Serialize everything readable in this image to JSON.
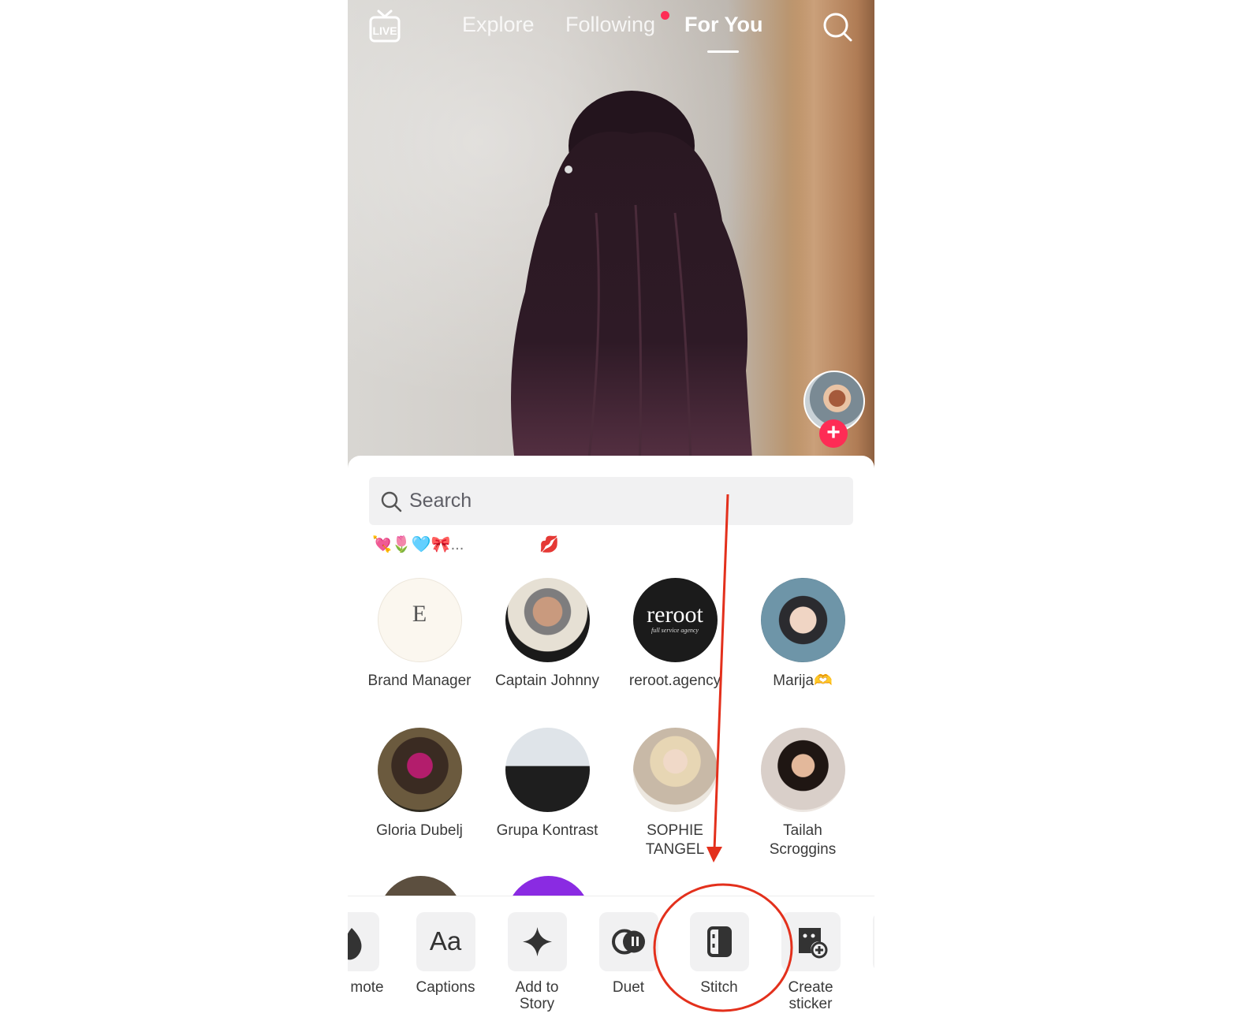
{
  "topnav": {
    "live_label": "LIVE",
    "tabs": [
      "Explore",
      "Following",
      "For You"
    ],
    "active_tab": "For You"
  },
  "share_sheet": {
    "search_placeholder": "Search",
    "emoji_row_1": "💘🌷🩵🎀...",
    "emoji_row_2": "💋",
    "contacts": [
      {
        "name": "Brand Manager",
        "avatar_text": "E"
      },
      {
        "name": "Captain Johnny"
      },
      {
        "name": "reroot.agency",
        "avatar_text": "reroot",
        "avatar_subtext": "full service agency"
      },
      {
        "name": "Marija🫶"
      },
      {
        "name": "Gloria Dubelj"
      },
      {
        "name": "Grupa Kontrast"
      },
      {
        "name": "SOPHIE TANGEL"
      },
      {
        "name": "Tailah Scroggins"
      }
    ],
    "actions": [
      {
        "label": "mote",
        "icon": "promote-flame-icon"
      },
      {
        "label": "Captions",
        "icon": "captions-aa-icon",
        "icon_text": "Aa"
      },
      {
        "label": "Add to Story",
        "icon": "sparkle-icon"
      },
      {
        "label": "Duet",
        "icon": "duet-icon"
      },
      {
        "label": "Stitch",
        "icon": "stitch-icon"
      },
      {
        "label": "Create sticker",
        "icon": "create-sticker-icon"
      }
    ]
  },
  "colors": {
    "accent_red": "#fe2c55",
    "annotation_red": "#e3301c"
  }
}
